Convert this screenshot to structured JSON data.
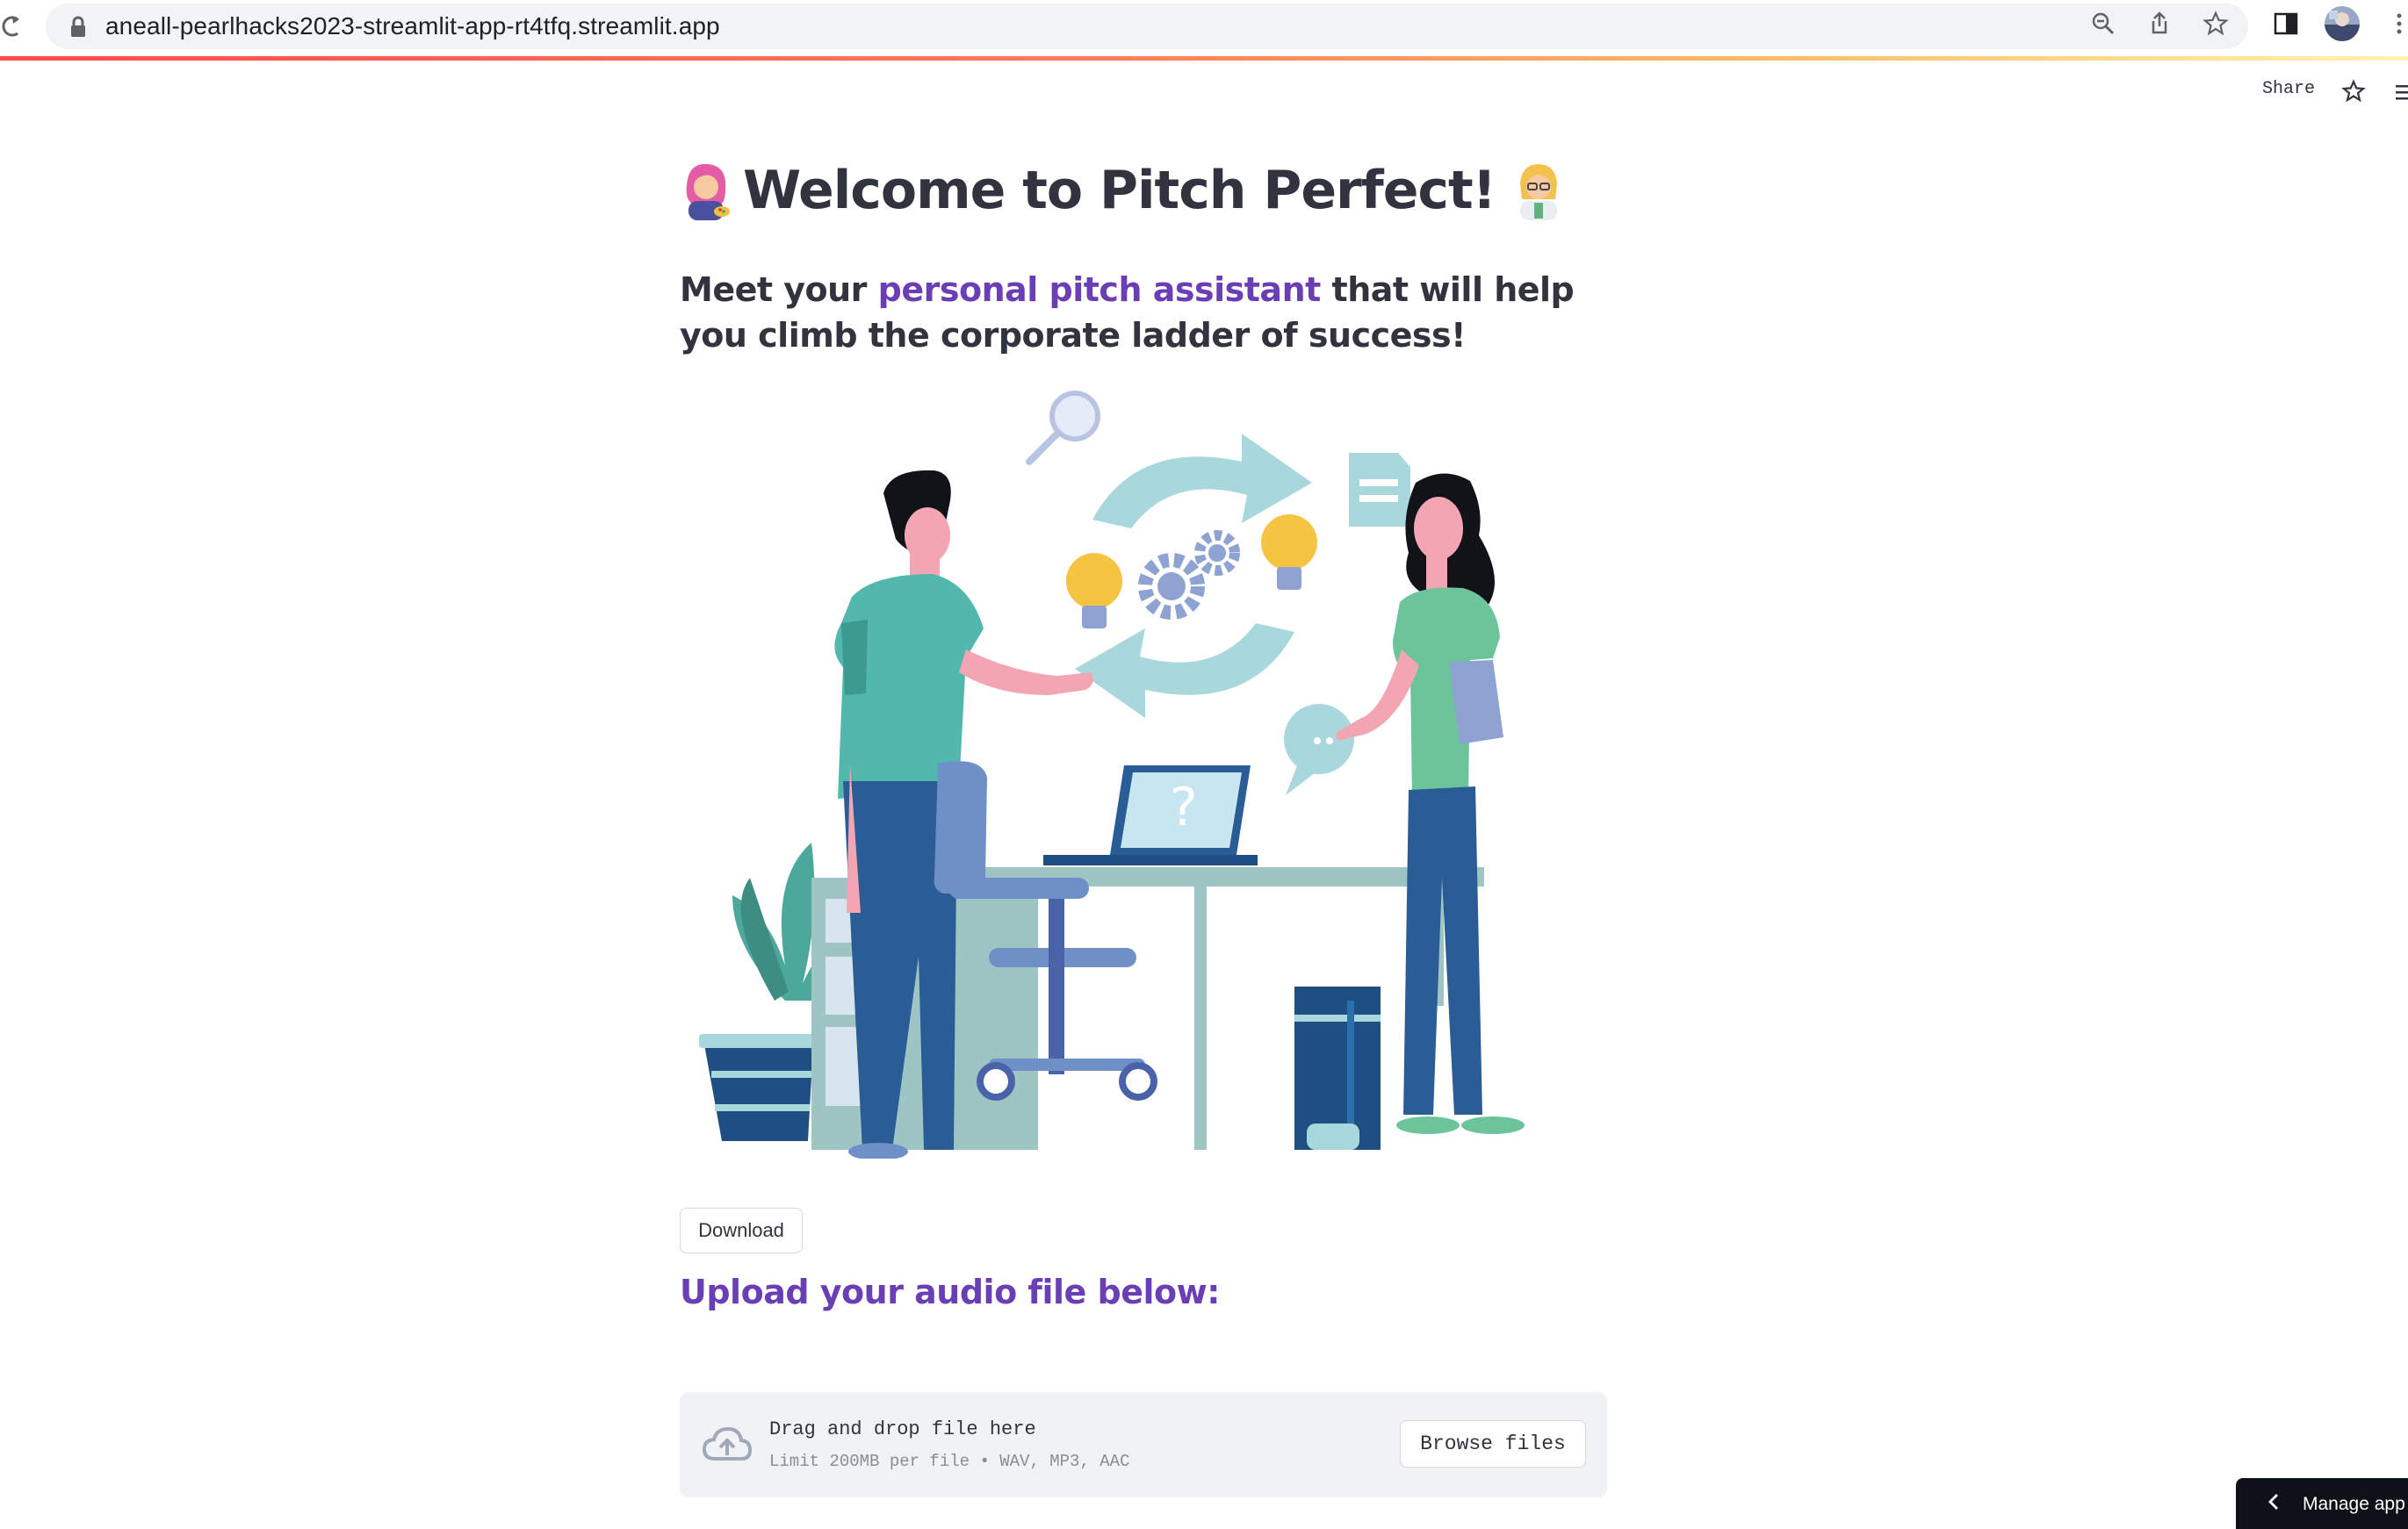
{
  "browser": {
    "url": "aneall-pearlhacks2023-streamlit-app-rt4tfq.streamlit.app",
    "icons": [
      "reload-icon",
      "lock-icon",
      "zoom-icon",
      "share-icon",
      "bookmark-star-icon",
      "side-panel-icon",
      "profile-avatar",
      "browser-menu-icon"
    ]
  },
  "header": {
    "share_label": "Share",
    "icons": [
      "star-icon",
      "hamburger-menu-icon"
    ]
  },
  "main": {
    "title": "Welcome to Pitch Perfect!",
    "title_emojis": [
      "woman-artist-emoji",
      "woman-scientist-emoji"
    ],
    "subtitle_before": "Meet your ",
    "subtitle_accent": "personal pitch assistant",
    "subtitle_after": " that will help you climb the corporate ladder of success!",
    "illustration": "two-people-collaborating-illustration",
    "download_label": "Download",
    "upload_heading": "Upload your audio file below:"
  },
  "uploader": {
    "title": "Drag and drop file here",
    "limit": "Limit 200MB per file • WAV, MP3, AAC",
    "browse_label": "Browse files",
    "icon": "cloud-upload-icon"
  },
  "footer": {
    "manage_label": "Manage app"
  },
  "colors": {
    "accent": "#6a3fb5",
    "text": "#31333f",
    "dropzone_bg": "#f0f2f6",
    "manage_bg": "#0e1117"
  }
}
